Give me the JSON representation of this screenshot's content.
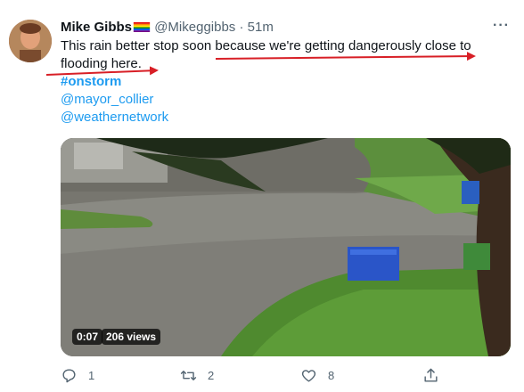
{
  "tweet": {
    "author": "Mike Gibbs",
    "handle": "@Mikeggibbs",
    "separator": "·",
    "time": "51m",
    "text_line1": "This rain better stop soon because we're getting dangerously close to",
    "text_line2": "flooding here.",
    "hashtag": "#onstorm",
    "mention1": "@mayor_collier",
    "mention2": "@weathernetwork"
  },
  "media": {
    "duration": "0:07",
    "views": "206 views"
  },
  "actions": {
    "replies": "1",
    "retweets": "2",
    "likes": "8"
  },
  "annotation_color": "#d81f26",
  "link_color": "#1d9bf0",
  "icons": [
    "more-icon",
    "reply-icon",
    "retweet-icon",
    "like-icon",
    "share-icon",
    "rainbow-flag-icon"
  ]
}
